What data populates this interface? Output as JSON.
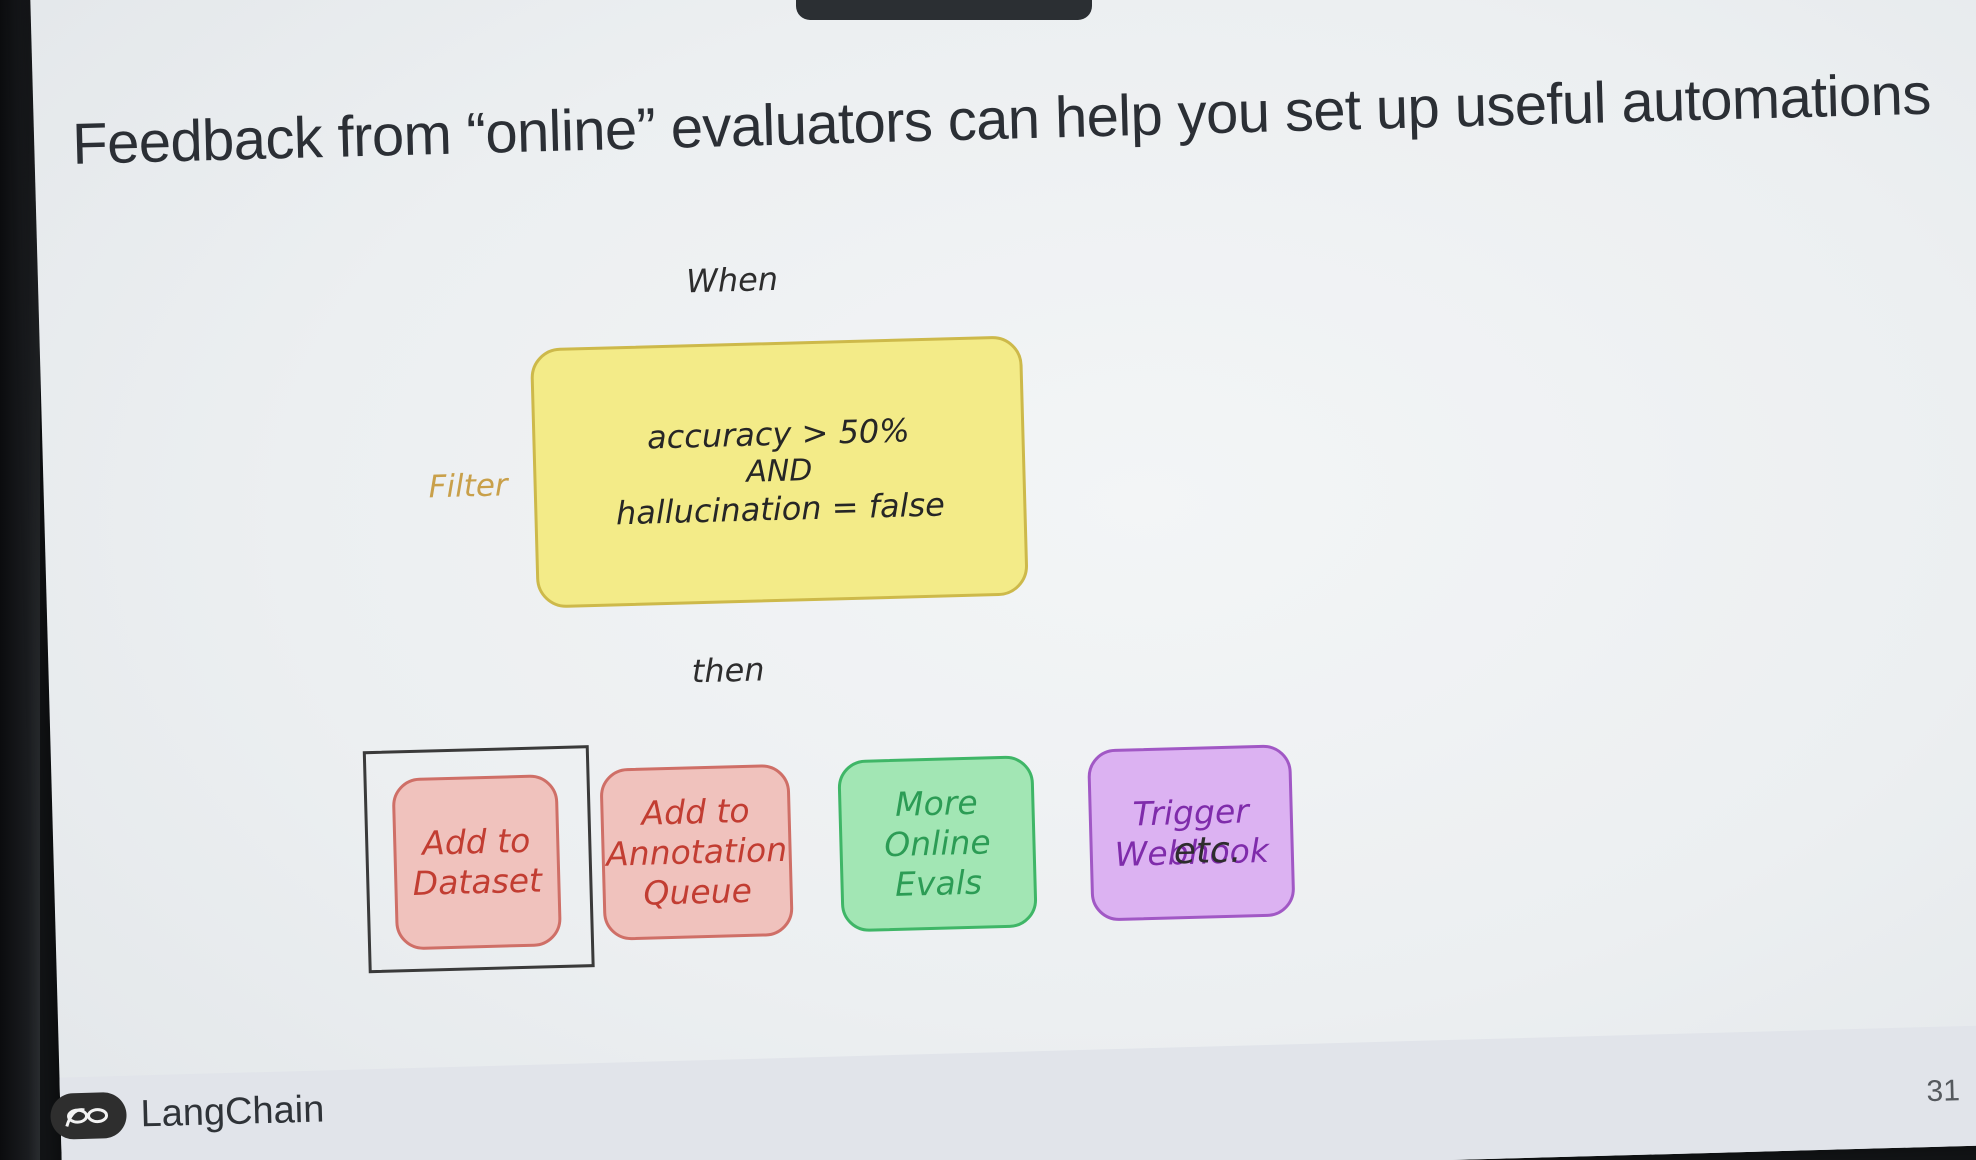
{
  "slide": {
    "title": "Feedback from “online” evaluators can help you set up useful automations",
    "when_label": "When",
    "then_label": "then",
    "filter": {
      "label": "Filter",
      "line1": "accuracy > 50%",
      "line2": "AND",
      "line3": "hallucination = false"
    },
    "actions": [
      {
        "line1": "Add to",
        "line2": "Dataset"
      },
      {
        "line1": "Add to",
        "line2": "Annotation",
        "line3": "Queue"
      },
      {
        "line1": "More Online",
        "line2": "Evals"
      },
      {
        "line1": "Trigger",
        "line2": "Webhook"
      }
    ],
    "etc_label": "etc.",
    "footer": {
      "brand": "LangChain",
      "page_number": "31"
    }
  },
  "colors": {
    "filter_fill": "#f3eb88",
    "red_action_fill": "#f0c2bd",
    "red_action_text": "#c23d32",
    "green_action_fill": "#a2e6b4",
    "green_action_text": "#2c9c55",
    "purple_action_fill": "#dcb2f2",
    "purple_action_text": "#7f2cab",
    "filter_label": "#c9a04a"
  },
  "icons": {
    "brand_logo": "langchain-parrot-chain-icon"
  }
}
